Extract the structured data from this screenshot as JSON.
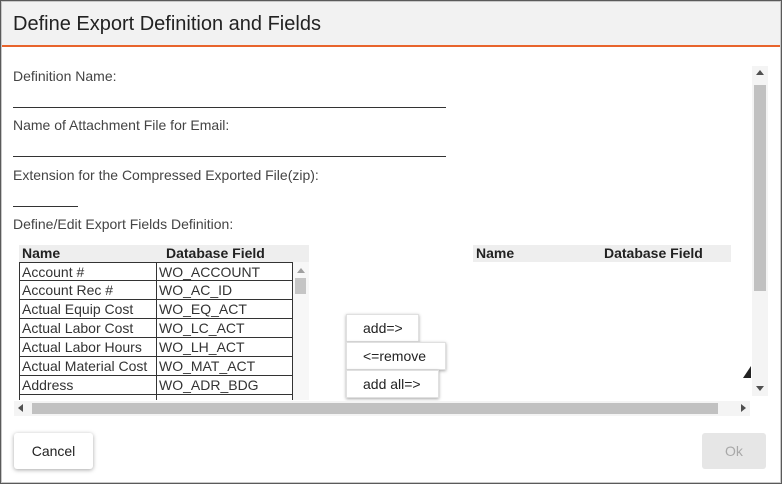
{
  "dialog": {
    "title": "Define Export Definition and Fields",
    "accent_color": "#e8642c"
  },
  "form": {
    "definition_name_label": "Definition Name:",
    "definition_name_value": "",
    "attachment_name_label": "Name of Attachment File for Email:",
    "attachment_name_value": "",
    "extension_label": "Extension for the Compressed Exported File(zip):",
    "extension_value": "",
    "fields_label": "Define/Edit Export Fields Definition:"
  },
  "available_fields": {
    "headers": [
      "Name",
      "Database Field"
    ],
    "rows": [
      [
        "Account #",
        "WO_ACCOUNT"
      ],
      [
        "Account Rec #",
        "WO_AC_ID"
      ],
      [
        "Actual Equip Cost",
        "WO_EQ_ACT"
      ],
      [
        "Actual Labor Cost",
        "WO_LC_ACT"
      ],
      [
        "Actual Labor Hours",
        "WO_LH_ACT"
      ],
      [
        "Actual Material Cost",
        "WO_MAT_ACT"
      ],
      [
        "Address",
        "WO_ADR_BDG"
      ]
    ]
  },
  "selected_fields": {
    "headers": [
      "Name",
      "Database Field"
    ]
  },
  "actions": {
    "add": "add=>",
    "remove": "<=remove",
    "add_all": "add all=>"
  },
  "footer": {
    "cancel": "Cancel",
    "ok": "Ok"
  }
}
